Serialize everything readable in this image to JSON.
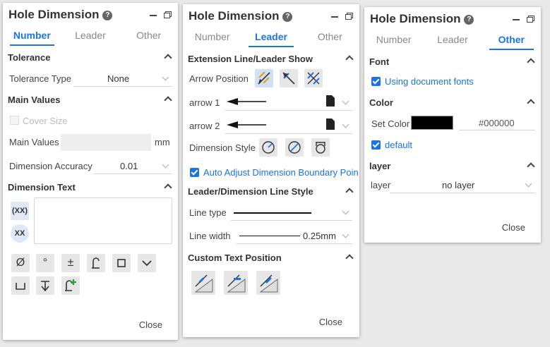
{
  "p1": {
    "title": "Hole Dimension",
    "tabs": [
      "Number",
      "Leader",
      "Other"
    ],
    "tolerance": {
      "heading": "Tolerance",
      "type_label": "Tolerance Type",
      "type_value": "None"
    },
    "main_values": {
      "heading": "Main Values",
      "cover_size": "Cover Size",
      "main_values_label": "Main Values",
      "unit": "mm",
      "accuracy_label": "Dimension Accuracy",
      "accuracy_value": "0.01"
    },
    "dim_text": {
      "heading": "Dimension Text",
      "xx1": "(XX)",
      "xx2": "XX"
    },
    "symbols": [
      "Ø",
      "°",
      "±",
      "",
      "",
      "",
      "",
      "",
      ""
    ],
    "close": "Close"
  },
  "p2": {
    "title": "Hole Dimension",
    "tabs": [
      "Number",
      "Leader",
      "Other"
    ],
    "ext_line": {
      "heading": "Extension Line/Leader Show",
      "arrow_position": "Arrow Position",
      "arrow1": "arrow 1",
      "arrow2": "arrow 2",
      "dim_style": "Dimension Style",
      "auto_adjust": "Auto Adjust Dimension Boundary Poin"
    },
    "line_style": {
      "heading": "Leader/Dimension Line Style",
      "line_type": "Line type",
      "line_width": "Line width",
      "line_width_value": "0.25mm"
    },
    "custom_text": {
      "heading": "Custom Text Position"
    },
    "close": "Close"
  },
  "p3": {
    "title": "Hole Dimension",
    "tabs": [
      "Number",
      "Leader",
      "Other"
    ],
    "font": {
      "heading": "Font",
      "using_doc_fonts": "Using document fonts"
    },
    "color": {
      "heading": "Color",
      "set_color": "Set Color",
      "hex": "#000000",
      "default": "default",
      "swatch": "#000000"
    },
    "layer": {
      "heading": "layer",
      "label": "layer",
      "value": "no layer"
    },
    "close": "Close"
  },
  "colors": {
    "accent": "#1a73e8"
  }
}
